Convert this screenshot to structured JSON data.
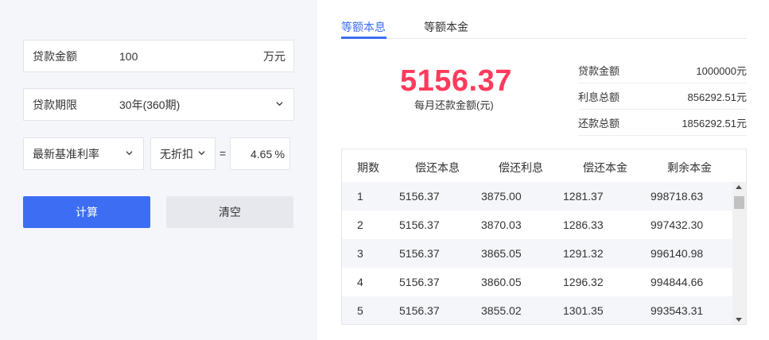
{
  "form": {
    "amount": {
      "label": "贷款金额",
      "value": "100",
      "unit": "万元"
    },
    "term": {
      "label": "贷款期限",
      "value": "30年(360期)"
    },
    "rate_type": {
      "value": "最新基准利率"
    },
    "discount": {
      "value": "无折扣"
    },
    "equals": "=",
    "rate": {
      "value": "4.65",
      "unit": "%"
    }
  },
  "buttons": {
    "calculate": "计算",
    "clear": "清空"
  },
  "tabs": [
    {
      "label": "等额本息",
      "active": true
    },
    {
      "label": "等额本金",
      "active": false
    }
  ],
  "result": {
    "monthly_payment": "5156.37",
    "monthly_label": "每月还款金额(元)",
    "summary": [
      {
        "label": "贷款金额",
        "value": "1000000元"
      },
      {
        "label": "利息总额",
        "value": "856292.51元"
      },
      {
        "label": "还款总额",
        "value": "1856292.51元"
      }
    ]
  },
  "table": {
    "headers": [
      "期数",
      "偿还本息",
      "偿还利息",
      "偿还本金",
      "剩余本金"
    ],
    "rows": [
      [
        "1",
        "5156.37",
        "3875.00",
        "1281.37",
        "998718.63"
      ],
      [
        "2",
        "5156.37",
        "3870.03",
        "1286.33",
        "997432.30"
      ],
      [
        "3",
        "5156.37",
        "3865.05",
        "1291.32",
        "996140.98"
      ],
      [
        "4",
        "5156.37",
        "3860.05",
        "1296.32",
        "994844.66"
      ],
      [
        "5",
        "5156.37",
        "3855.02",
        "1301.35",
        "993543.31"
      ]
    ]
  },
  "colors": {
    "accent": "#3d6df2",
    "highlight": "#ff3b5c",
    "panel_bg": "#f5f6fa"
  }
}
